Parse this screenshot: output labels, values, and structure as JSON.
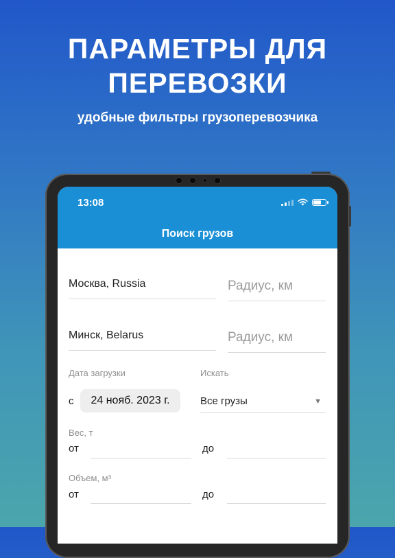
{
  "promo": {
    "headline_line1": "ПАРАМЕТРЫ ДЛЯ",
    "headline_line2": "ПЕРЕВОЗКИ",
    "subheadline": "удобные фильтры грузоперевозчика"
  },
  "status_bar": {
    "time": "13:08",
    "icons": [
      "signal-icon",
      "wifi-icon",
      "battery-icon"
    ]
  },
  "app_bar": {
    "title": "Поиск грузов"
  },
  "form": {
    "origin": {
      "value": "Москва, Russia"
    },
    "origin_radius": {
      "placeholder": "Радиус, км"
    },
    "destination": {
      "value": "Минск, Belarus"
    },
    "destination_radius": {
      "placeholder": "Радиус, км"
    },
    "load_date": {
      "label": "Дата загрузки",
      "prefix": "с",
      "value": "24 нояб. 2023 г."
    },
    "search_type": {
      "label": "Искать",
      "value": "Все грузы"
    },
    "weight": {
      "label": "Вес, т",
      "from_label": "от",
      "to_label": "до"
    },
    "volume": {
      "label": "Объем, м³",
      "from_label": "от",
      "to_label": "до"
    }
  },
  "colors": {
    "app_bar": "#1a8fd6",
    "bg_top": "#2157c9",
    "bg_bottom": "#4aa6ac"
  }
}
